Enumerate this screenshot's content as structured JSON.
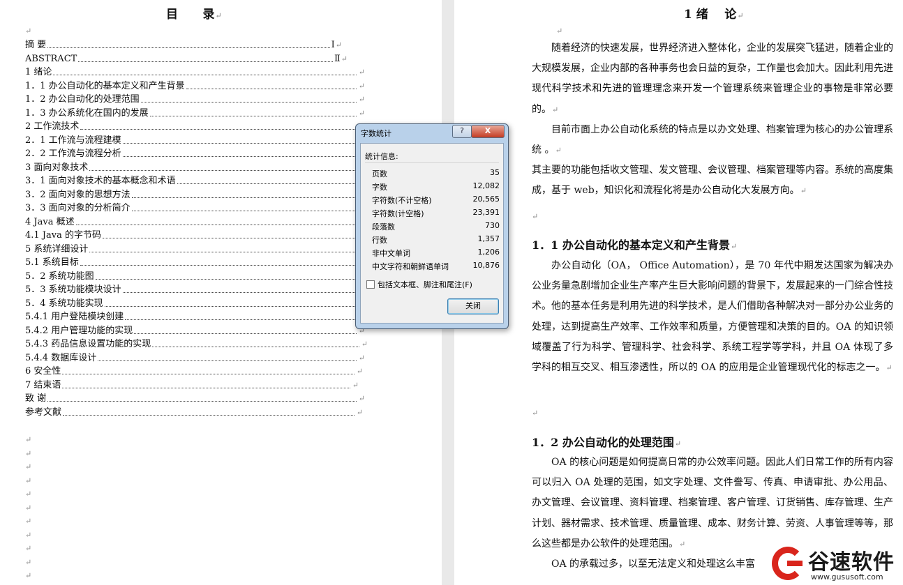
{
  "toc": {
    "title": "目      录",
    "entries": [
      {
        "text": "摘  要",
        "page": "Ⅰ"
      },
      {
        "text": "ABSTRACT",
        "page": "Ⅱ"
      },
      {
        "text": "1  绪论",
        "page": ""
      },
      {
        "text": "1．1 办公自动化的基本定义和产生背景",
        "page": ""
      },
      {
        "text": "1．2 办公自动化的处理范围",
        "page": ""
      },
      {
        "text": "1．3 办公系统化在国内的发展",
        "page": ""
      },
      {
        "text": "2  工作流技术",
        "page": ""
      },
      {
        "text": "2．1  工作流与流程建模",
        "page": ""
      },
      {
        "text": "2．2 工作流与流程分析",
        "page": ""
      },
      {
        "text": "3  面向对象技术",
        "page": ""
      },
      {
        "text": "3．1  面向对象技术的基本概念和术语",
        "page": ""
      },
      {
        "text": "3．2  面向对象的思想方法",
        "page": ""
      },
      {
        "text": "3．3  面向对象的分析简介",
        "page": ""
      },
      {
        "text": "4 Java 概述",
        "page": ""
      },
      {
        "text": "4.1 Java 的字节码",
        "page": ""
      },
      {
        "text": "5  系统详细设计",
        "page": ""
      },
      {
        "text": "5.1  系统目标",
        "page": ""
      },
      {
        "text": "5．2  系统功能图",
        "page": ""
      },
      {
        "text": "5．3  系统功能模块设计",
        "page": ""
      },
      {
        "text": "5．4  系统功能实现",
        "page": ""
      },
      {
        "text": "5.4.1  用户登陆模块创建",
        "page": ""
      },
      {
        "text": "5.4.2  用户管理功能的实现",
        "page": ""
      },
      {
        "text": "5.4.3  药品信息设置功能的实现",
        "page": ""
      },
      {
        "text": "5.4.4  数据库设计",
        "page": ""
      },
      {
        "text": "6  安全性",
        "page": ""
      },
      {
        "text": "7  结束语",
        "page": ""
      },
      {
        "text": "致  谢",
        "page": ""
      },
      {
        "text": "参考文献",
        "page": ""
      }
    ]
  },
  "document": {
    "chapter_title": "1 绪    论",
    "paragraphs": [
      "随着经济的快速发展，世界经济进入整体化，企业的发展突飞猛进，随着企业的大规模发展，企业内部的各种事务也会日益的复杂，工作量也会加大。因此利用先进现代科学技术和先进的管理理念来开发一个管理系统来管理企业的事物是非常必要的。",
      "目前市面上办公自动化系统的特点是以办文处理、档案管理为核心的办公管理系统  。",
      "其主要的功能包括收文管理、发文管理、会议管理、档案管理等内容。系统的高度集成，基于 web，知识化和流程化将是办公自动化大发展方向。"
    ],
    "section1_title": "1．1 办公自动化的基本定义和产生背景",
    "section1_paragraph": "办公自动化（OA， Office  Automation），是 70 年代中期发达国家为解决办公业务量急剧增加企业生产率产生巨大影响问题的背景下，发展起来的一门综合性技术。他的基本任务是利用先进的科学技术，是人们借助各种解决对一部分办公业务的处理，达到提高生产效率、工作效率和质量，方便管理和决策的目的。OA 的知识领域覆盖了行为科学、管理科学、社会科学、系统工程学等学科，并且 OA 体现了多学科的相互交叉、相互渗透性，所以的 OA 的应用是企业管理现代化的标志之一。",
    "section2_title": "1．2 办公自动化的处理范围",
    "section2_paragraph": "OA 的核心问题是如何提高日常的办公效率问题。因此人们日常工作的所有内容可以归入 OA 处理的范围，如文字处理、文件誊写、传真、申请审批、办公用品、办文管理、会议管理、资料管理、档案管理、客户管理、订货销售、库存管理、生产计划、器材需求、技术管理、质量管理、成本、财务计算、劳资、人事管理等等，那么这些都是办公软件的处理范围。",
    "section2_paragraph2": "OA 的承载过多，以至无法定义和处理这么丰富"
  },
  "dialog": {
    "title": "字数统计",
    "help_label": "?",
    "close_x": "X",
    "group_label": "统计信息:",
    "stats": [
      {
        "label": "页数",
        "value": "35"
      },
      {
        "label": "字数",
        "value": "12,082"
      },
      {
        "label": "字符数(不计空格)",
        "value": "20,565"
      },
      {
        "label": "字符数(计空格)",
        "value": "23,391"
      },
      {
        "label": "段落数",
        "value": "730"
      },
      {
        "label": "行数",
        "value": "1,357"
      },
      {
        "label": "非中文单词",
        "value": "1,206"
      },
      {
        "label": "中文字符和朝鲜语单词",
        "value": "10,876"
      }
    ],
    "checkbox_label": "包括文本框、脚注和尾注(F)",
    "checkbox_checked": false,
    "close_button_label": "关闭"
  },
  "watermark": {
    "name": "谷速软件",
    "url": "www.gususoft.com"
  }
}
